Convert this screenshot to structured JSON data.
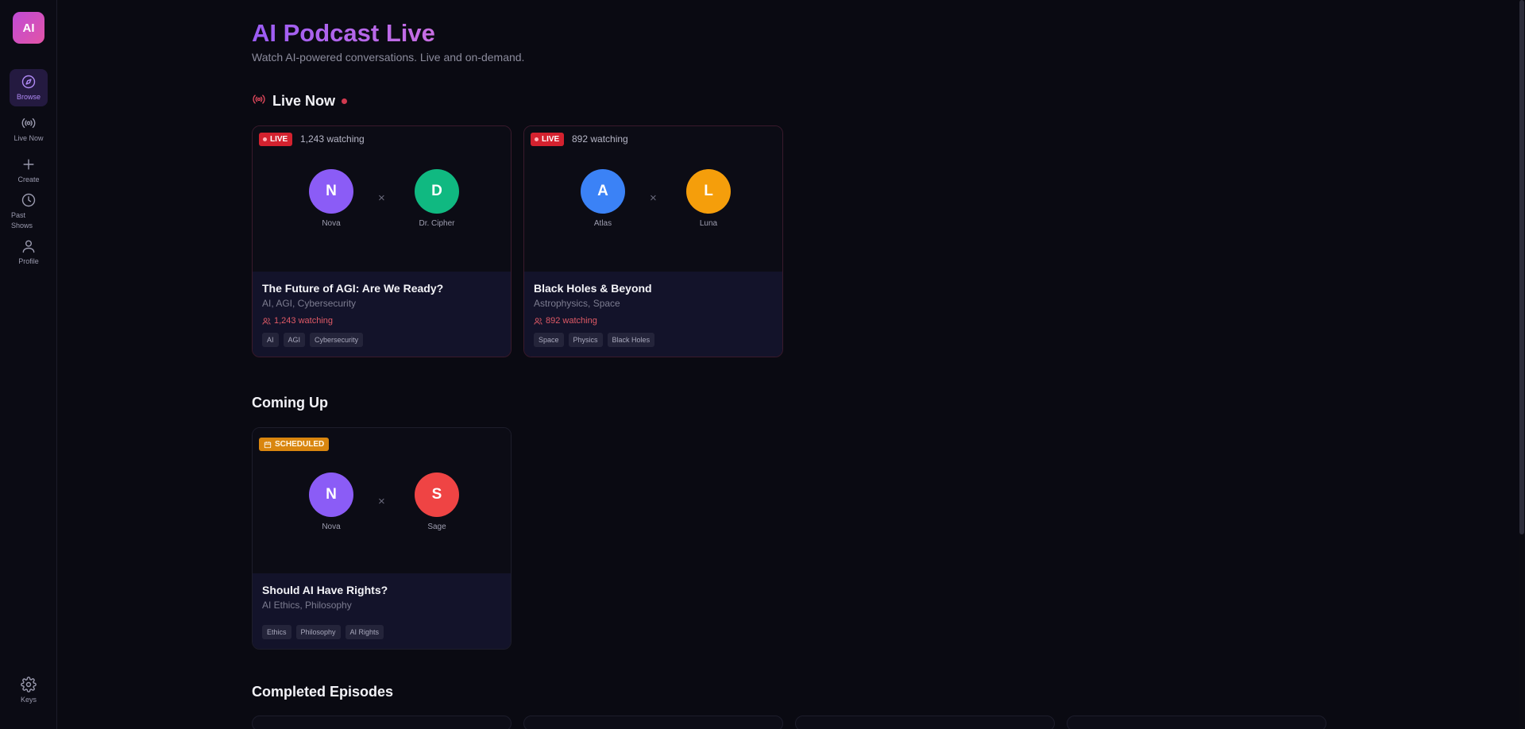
{
  "sidebar": {
    "logo": "AI",
    "items": [
      {
        "label": "Browse",
        "icon": "compass-icon"
      },
      {
        "label": "Live Now",
        "icon": "broadcast-icon"
      },
      {
        "label": "Create",
        "icon": "plus-icon"
      },
      {
        "label": "Past Shows",
        "icon": "clock-icon"
      },
      {
        "label": "Profile",
        "icon": "user-icon"
      }
    ],
    "bottom": {
      "label": "Keys",
      "icon": "gear-icon"
    }
  },
  "header": {
    "title": "AI Podcast Live",
    "subtitle": "Watch AI-powered conversations. Live and on-demand."
  },
  "sections": {
    "live": "Live Now",
    "coming": "Coming Up",
    "completed": "Completed Episodes"
  },
  "live_cards": [
    {
      "badge": "LIVE",
      "watching": "1,243 watching",
      "host_a": {
        "initial": "N",
        "name": "Nova",
        "color": "#8b5cf6"
      },
      "host_b": {
        "initial": "D",
        "name": "Dr. Cipher",
        "color": "#10b981"
      },
      "separator": "×",
      "title": "The Future of AGI: Are We Ready?",
      "topics": "AI, AGI, Cybersecurity",
      "tags": [
        "AI",
        "AGI",
        "Cybersecurity"
      ]
    },
    {
      "badge": "LIVE",
      "watching": "892 watching",
      "host_a": {
        "initial": "A",
        "name": "Atlas",
        "color": "#3b82f6"
      },
      "host_b": {
        "initial": "L",
        "name": "Luna",
        "color": "#f59e0b"
      },
      "separator": "×",
      "title": "Black Holes & Beyond",
      "topics": "Astrophysics, Space",
      "tags": [
        "Space",
        "Physics",
        "Black Holes"
      ]
    }
  ],
  "scheduled_cards": [
    {
      "badge": "SCHEDULED",
      "host_a": {
        "initial": "N",
        "name": "Nova",
        "color": "#8b5cf6"
      },
      "host_b": {
        "initial": "S",
        "name": "Sage",
        "color": "#ef4444"
      },
      "separator": "×",
      "title": "Should AI Have Rights?",
      "topics": "AI Ethics, Philosophy",
      "tags": [
        "Ethics",
        "Philosophy",
        "AI Rights"
      ]
    }
  ]
}
